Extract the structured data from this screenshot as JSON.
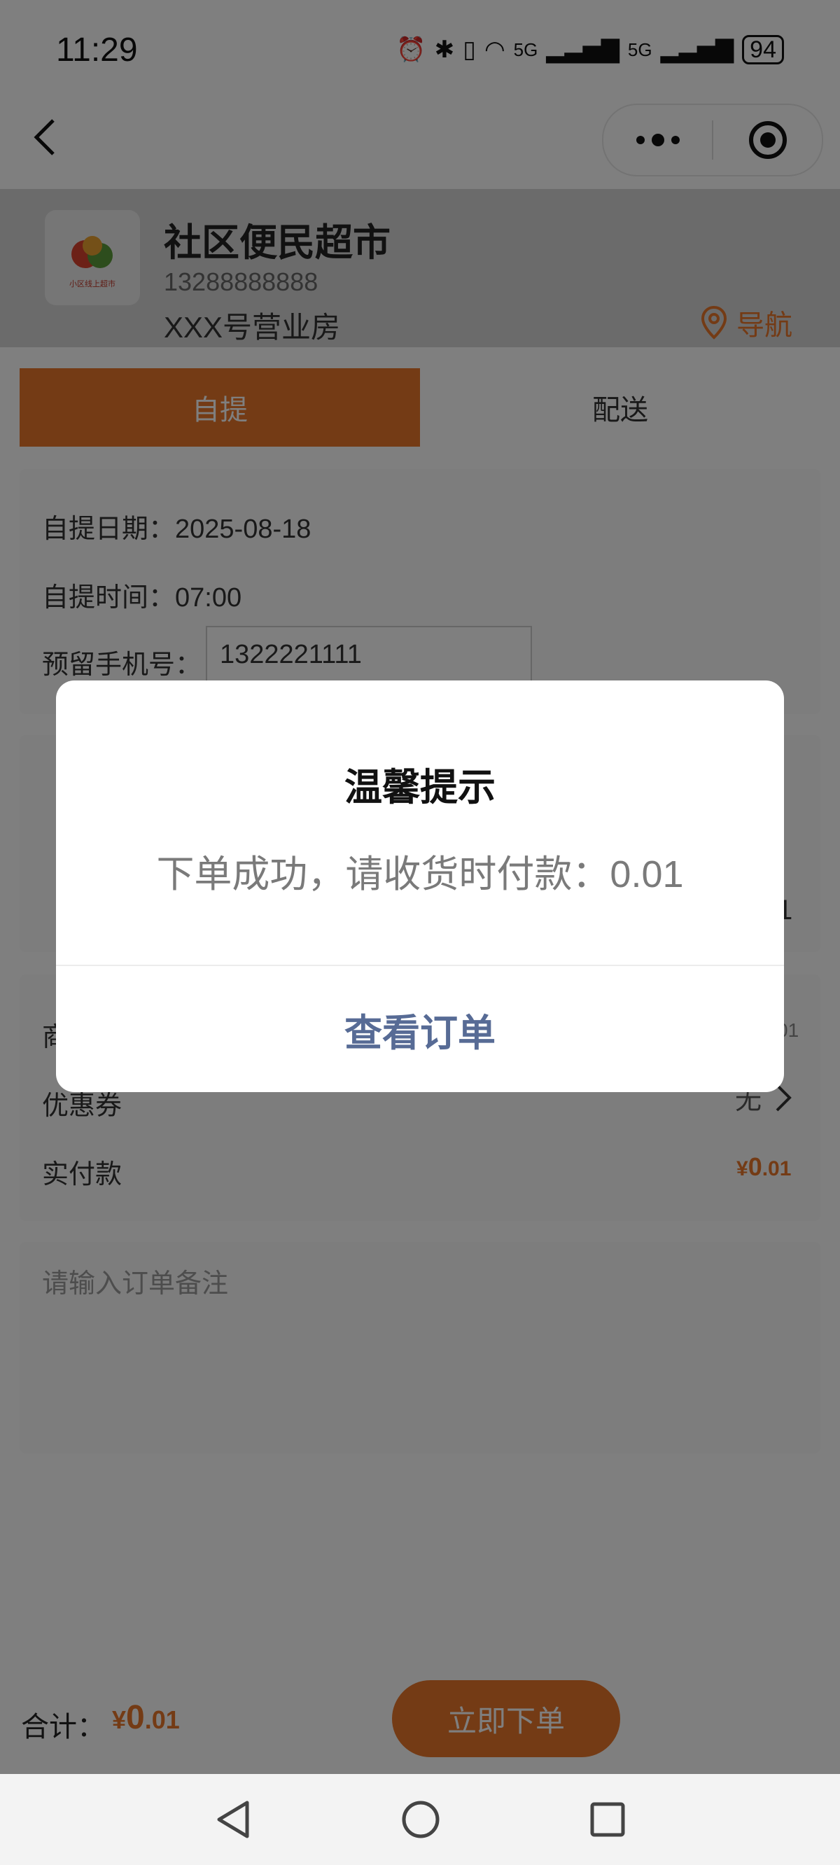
{
  "status_bar": {
    "time": "11:29",
    "network_1": "5G",
    "network_2": "5G",
    "battery": "94"
  },
  "shop": {
    "name": "社区便民超市",
    "phone": "13288888888",
    "address": "XXX号营业房",
    "nav_label": "导航",
    "logo_text": "小区线上超市"
  },
  "tabs": {
    "pickup": "自提",
    "delivery": "配送",
    "active": "自提"
  },
  "pickup_form": {
    "date_label": "自提日期：",
    "date_value": "2025-08-18",
    "time_label": "自提时间：",
    "time_value": "07:00",
    "phone_label": "预留手机号：",
    "phone_value": "1322221111"
  },
  "items_card": {
    "quantity_edge": "1"
  },
  "price_card": {
    "goods_label_partial": "商",
    "goods_value_partial": "01",
    "coupon_label": "优惠券",
    "coupon_value": "无",
    "paid_label": "实付款",
    "paid_currency": "¥",
    "paid_int": "0",
    "paid_dec": ".01"
  },
  "remark": {
    "placeholder": "请输入订单备注"
  },
  "bottom_bar": {
    "total_label": "合计：",
    "currency": "¥",
    "amount_int": "0",
    "amount_dec": ".01",
    "submit_label": "立即下单"
  },
  "modal": {
    "title": "温馨提示",
    "message": "下单成功，请收货时付款：0.01",
    "button": "查看订单"
  },
  "colors": {
    "accent": "#e8762b",
    "link": "#576b95"
  }
}
